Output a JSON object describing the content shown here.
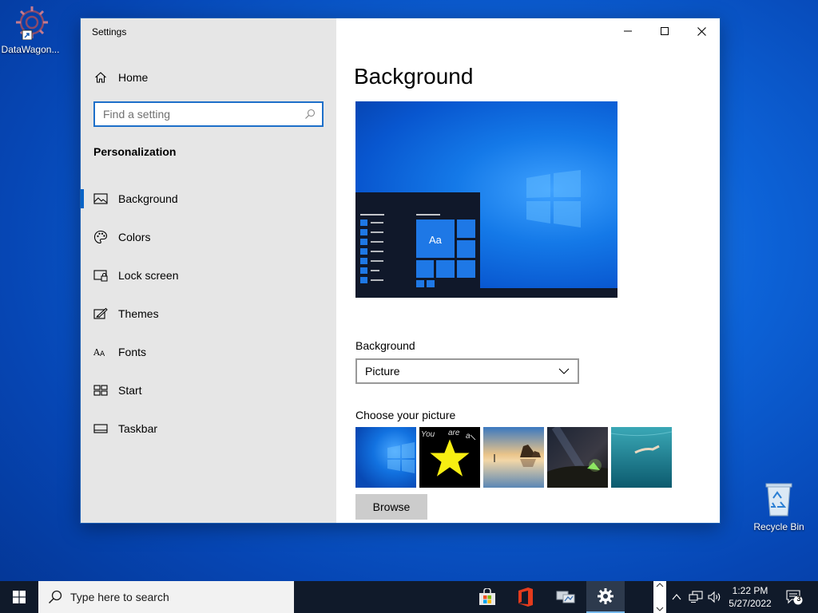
{
  "desktop": {
    "icons": [
      {
        "label": "DataWagon...",
        "icon": "gear-shortcut-icon"
      },
      {
        "label": "Recycle Bin",
        "icon": "recycle-bin-icon"
      }
    ]
  },
  "window": {
    "title": "Settings",
    "controls": [
      "minimize",
      "maximize",
      "close"
    ]
  },
  "nav": {
    "home_label": "Home",
    "search_placeholder": "Find a setting",
    "section_title": "Personalization",
    "items": [
      {
        "label": "Background",
        "icon": "picture-icon",
        "active": true
      },
      {
        "label": "Colors",
        "icon": "palette-icon"
      },
      {
        "label": "Lock screen",
        "icon": "lock-screen-icon"
      },
      {
        "label": "Themes",
        "icon": "themes-brush-icon"
      },
      {
        "label": "Fonts",
        "icon": "fonts-icon"
      },
      {
        "label": "Start",
        "icon": "start-tiles-icon"
      },
      {
        "label": "Taskbar",
        "icon": "taskbar-icon"
      }
    ]
  },
  "content": {
    "page_title": "Background",
    "preview_tile_text": "Aa",
    "background_label": "Background",
    "background_value": "Picture",
    "choose_label": "Choose your picture",
    "thumbnail_text": [
      "You",
      "are",
      "a"
    ],
    "browse_label": "Browse"
  },
  "taskbar": {
    "search_placeholder": "Type here to search",
    "apps": [
      "store-icon",
      "office-icon",
      "network-app-icon",
      "settings-gear-icon"
    ],
    "time": "1:22 PM",
    "date": "5/27/2022",
    "notification_count": "3"
  },
  "colors": {
    "accent": "#0a64c6",
    "nav_bg": "#e6e6e6",
    "taskbar_bg": "#101a2a"
  }
}
